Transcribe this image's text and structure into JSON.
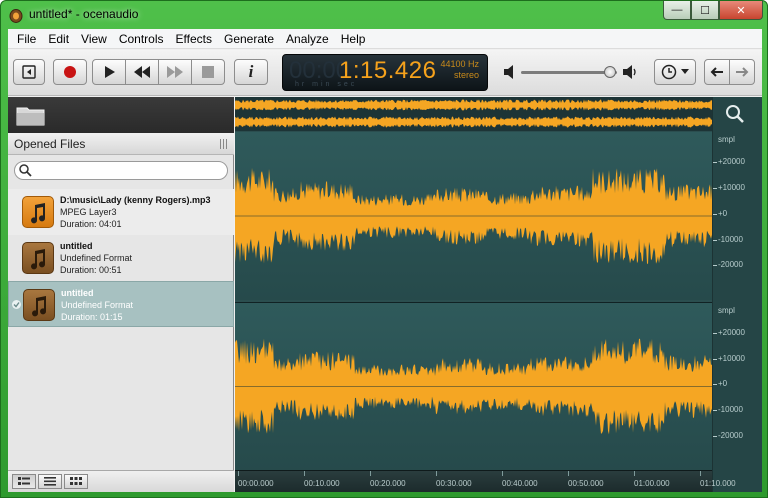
{
  "window": {
    "title": "untitled* - ocenaudio",
    "controls": {
      "minimize": "—",
      "maximize": "☐",
      "close": "✕"
    }
  },
  "menu": [
    "File",
    "Edit",
    "View",
    "Controls",
    "Effects",
    "Generate",
    "Analyze",
    "Help"
  ],
  "toolbar": {
    "buttons": [
      "go-to-start",
      "record",
      "play",
      "rewind",
      "fast-forward",
      "stop",
      "info"
    ],
    "info_label": "i",
    "time_display": {
      "ghost": "00:00",
      "time": "1:15.426",
      "units": "hr   min sec",
      "sample_rate": "44100 Hz",
      "channels": "stereo"
    },
    "volume_level": 0.93,
    "history_icon": "clock-icon",
    "nav_back": "arrow-left-icon",
    "nav_forward": "arrow-right-icon"
  },
  "sidebar": {
    "header": "Opened Files",
    "search_placeholder": "",
    "files": [
      {
        "name": "D:\\music\\Lady (kenny Rogers).mp3",
        "format": "MPEG Layer3",
        "duration": "Duration: 04:01",
        "thumb": "orange",
        "selected": false
      },
      {
        "name": "untitled",
        "format": "Undefined Format",
        "duration": "Duration: 00:51",
        "thumb": "brown",
        "selected": false
      },
      {
        "name": "untitled",
        "format": "Undefined Format",
        "duration": "Duration: 01:15",
        "thumb": "brown",
        "selected": true
      }
    ],
    "view_modes": [
      "detail-view",
      "list-view",
      "grid-view"
    ]
  },
  "waveform": {
    "wave_color": "#f5a623",
    "unit": "smpl",
    "scale_labels": [
      "+20000",
      "+10000",
      "+0",
      "-10000",
      "-20000"
    ],
    "timeline": [
      "00:00.000",
      "00:10.000",
      "00:20.000",
      "00:30.000",
      "00:40.000",
      "00:50.000",
      "01:00.000",
      "01:10.000"
    ]
  }
}
